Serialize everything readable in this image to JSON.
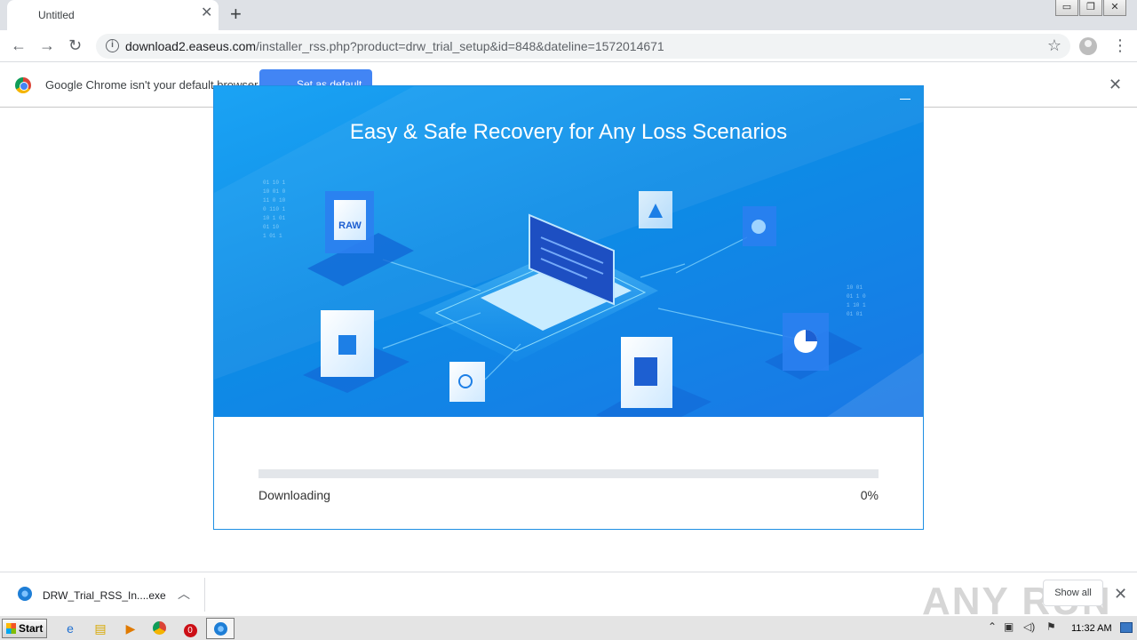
{
  "browser": {
    "tab_title": "Untitled",
    "tab_close": "✕",
    "new_tab": "+",
    "window_controls": [
      "▭",
      "❐",
      "✕"
    ],
    "url_host": "download2.easeus.com",
    "url_rest": "/installer_rss.php?product=drw_trial_setup&id=848&dateline=1572014671",
    "icons": [
      "back-arrow-icon",
      "forward-arrow-icon",
      "reload-icon",
      "info-icon",
      "star-icon",
      "profile-icon",
      "menu-icon"
    ]
  },
  "infobar": {
    "message": "Google Chrome isn't your default browser",
    "button_label": "Set as default",
    "close": "✕"
  },
  "installer": {
    "title": "Easy & Safe Recovery for Any Loss Scenarios",
    "raw_label": "RAW",
    "progress_fraction": 0,
    "status": "Downloading",
    "percent": "0%"
  },
  "download_bar": {
    "file_name": "DRW_Trial_RSS_In....exe",
    "show_all": "Show all",
    "watermark": "ANY RUN",
    "close": "✕"
  },
  "taskbar": {
    "start_label": "Start",
    "clock": "11:32 AM"
  },
  "colors": {
    "accent": "#1e8fe3",
    "hero_gradient_start": "#1ba3f4",
    "hero_gradient_end": "#1a78e6",
    "chrome_button": "#4285f4"
  }
}
